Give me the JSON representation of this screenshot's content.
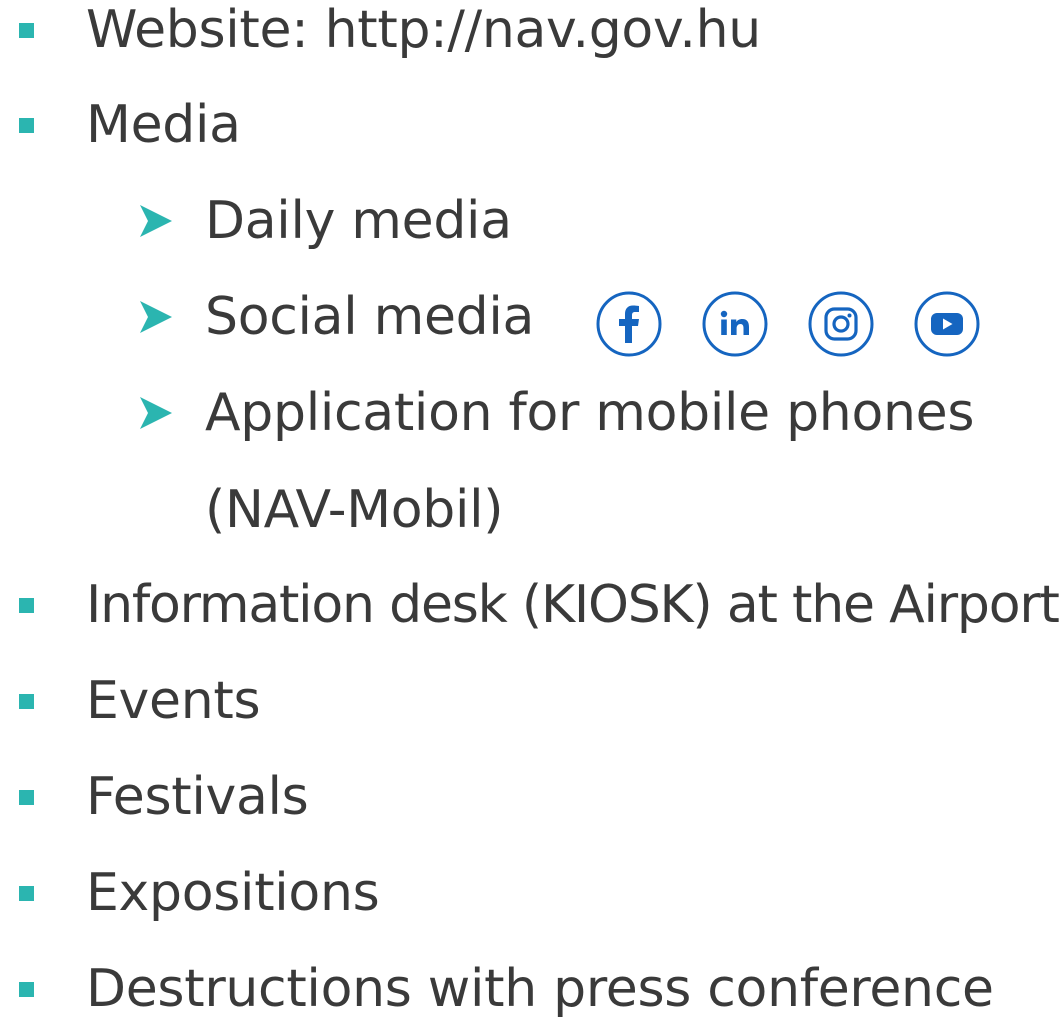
{
  "items": [
    {
      "text": "Website: http://nav.gov.hu"
    },
    {
      "text": "Media"
    },
    {
      "text": "Information desk (KIOSK) at the Airport"
    },
    {
      "text": "Events"
    },
    {
      "text": "Festivals"
    },
    {
      "text": "Expositions"
    },
    {
      "text": "Destructions with press conference"
    }
  ],
  "media_sub": [
    {
      "text": "Daily media"
    },
    {
      "text": "Social media"
    },
    {
      "text": "Application for mobile phones"
    },
    {
      "text": "(NAV-Mobil)"
    }
  ],
  "social_icons": [
    "facebook-icon",
    "linkedin-icon",
    "instagram-icon",
    "youtube-icon"
  ],
  "colors": {
    "bullet": "#2bb5b0",
    "arrow": "#2bb5b0",
    "icon": "#1565c0",
    "text": "#3a3a3a"
  }
}
